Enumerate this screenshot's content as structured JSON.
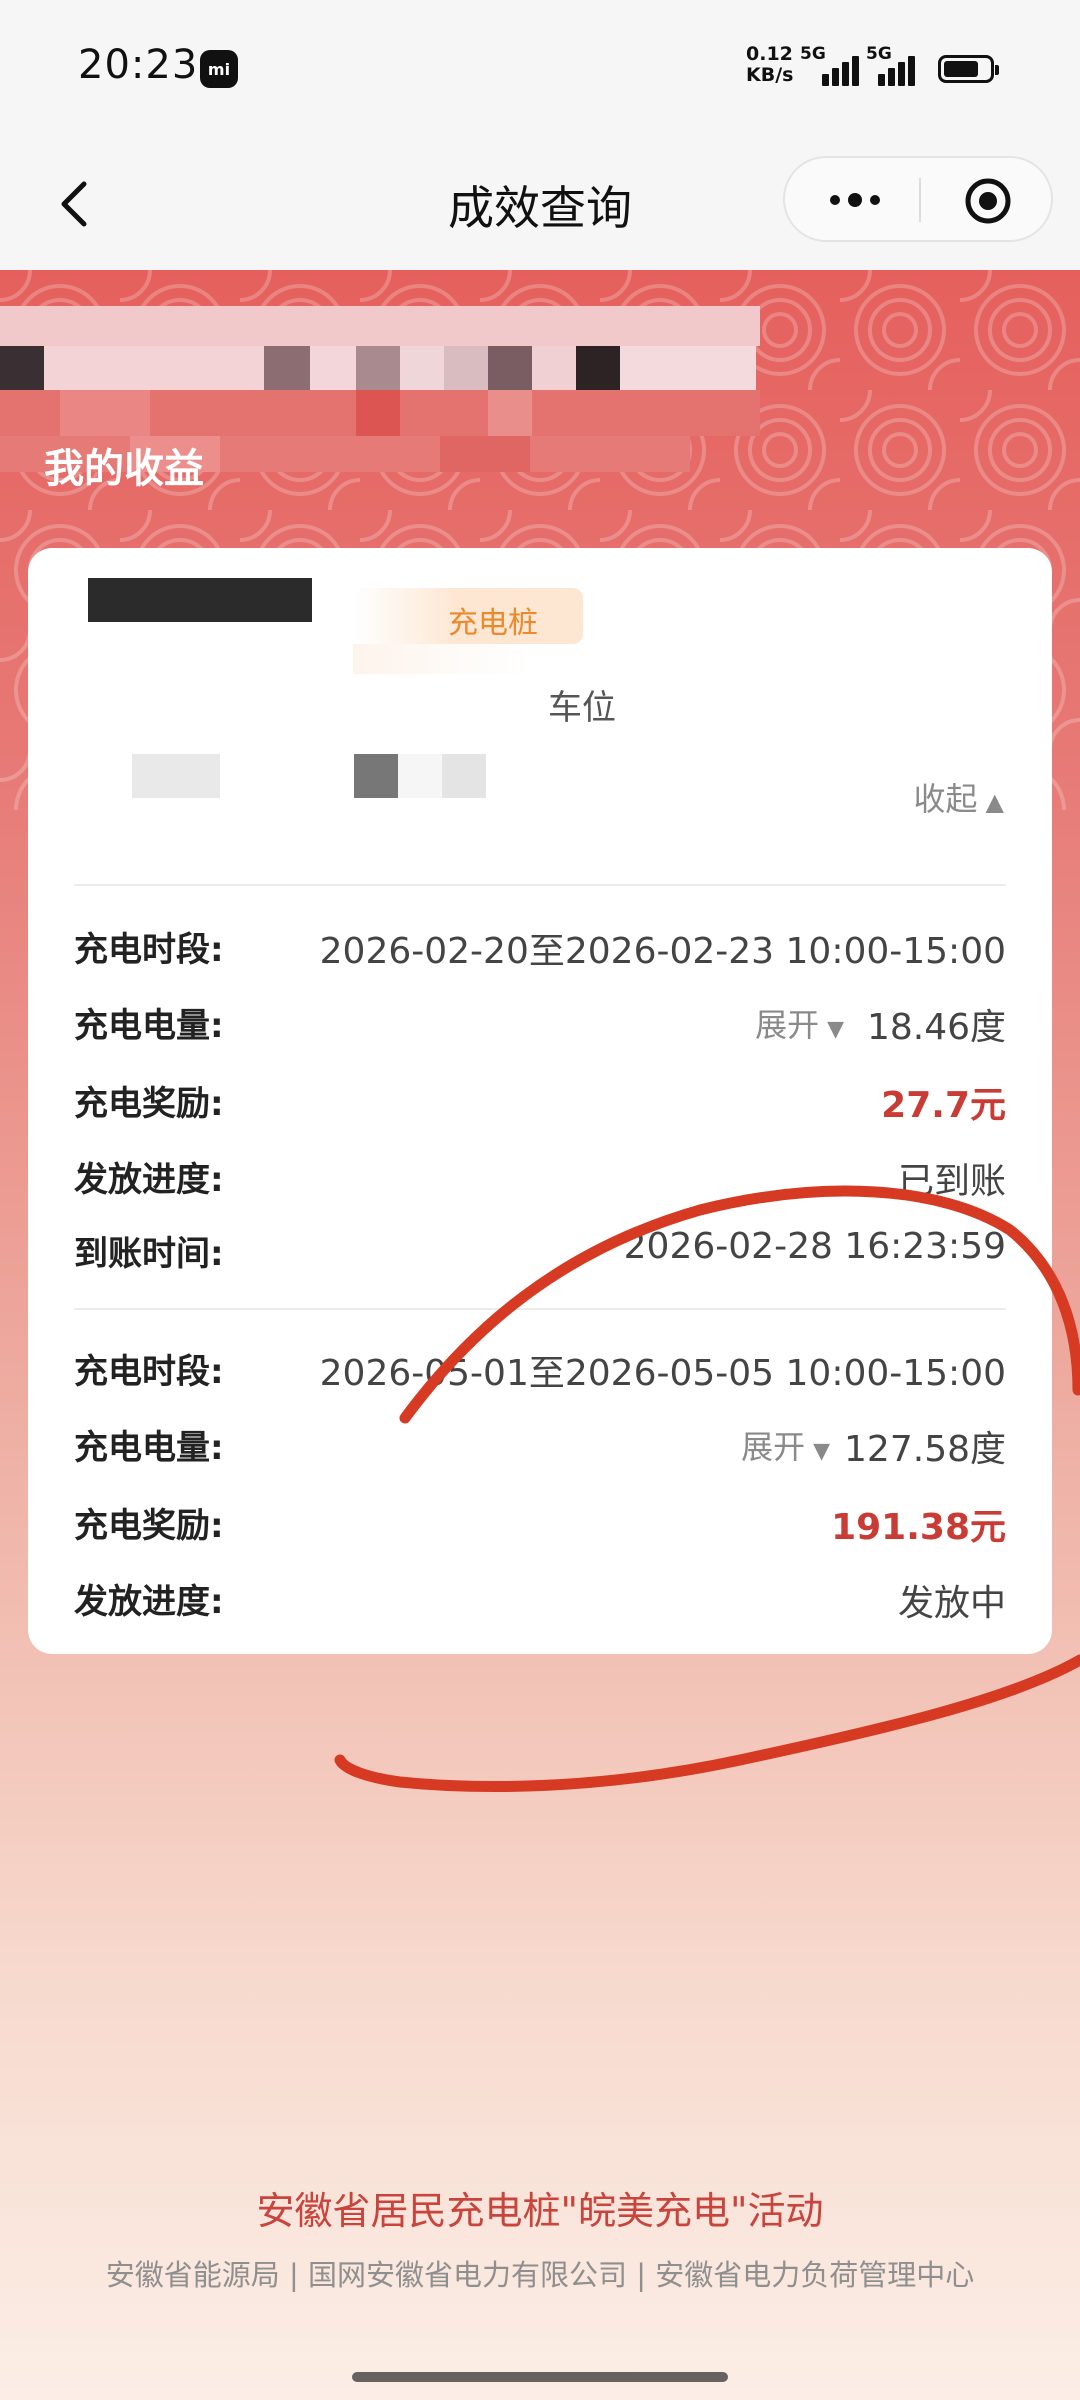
{
  "status_bar": {
    "time": "20:23",
    "mi_badge": "mi",
    "net_speed_value": "0.12",
    "net_speed_unit": "KB/s",
    "sim1_label": "5G",
    "sim2_label": "5G",
    "icons": [
      "mi-icon",
      "signal-icon",
      "battery-icon"
    ]
  },
  "nav": {
    "title": "成效查询",
    "icons": [
      "back-icon",
      "more-icon",
      "target-icon"
    ]
  },
  "hero": {
    "title": "我的收益"
  },
  "card": {
    "tag": "充电桩",
    "subtitle": "车位",
    "collapse_label": "收起",
    "records": [
      {
        "period_label": "充电时段:",
        "period_value": "2026-02-20至2026-02-23 10:00-15:00",
        "energy_label": "充电电量:",
        "expand_label": "展开",
        "energy_value": "18.46度",
        "reward_label": "充电奖励:",
        "reward_value": "27.7元",
        "progress_label": "发放进度:",
        "progress_value": "已到账",
        "arrival_label": "到账时间:",
        "arrival_value": "2026-02-28 16:23:59"
      },
      {
        "period_label": "充电时段:",
        "period_value": "2026-05-01至2026-05-05 10:00-15:00",
        "energy_label": "充电电量:",
        "expand_label": "展开",
        "energy_value": "127.58度",
        "reward_label": "充电奖励:",
        "reward_value": "191.38元",
        "progress_label": "发放进度:",
        "progress_value": "发放中"
      }
    ]
  },
  "footer": {
    "title": "安徽省居民充电桩\"皖美充电\"活动",
    "orgs": "安徽省能源局 | 国网安徽省电力有限公司 | 安徽省电力负荷管理中心"
  },
  "colors": {
    "accent_red": "#c93c35",
    "hero_red": "#e5605d",
    "tag_orange": "#e98a2e",
    "scribble": "#d63a22"
  }
}
